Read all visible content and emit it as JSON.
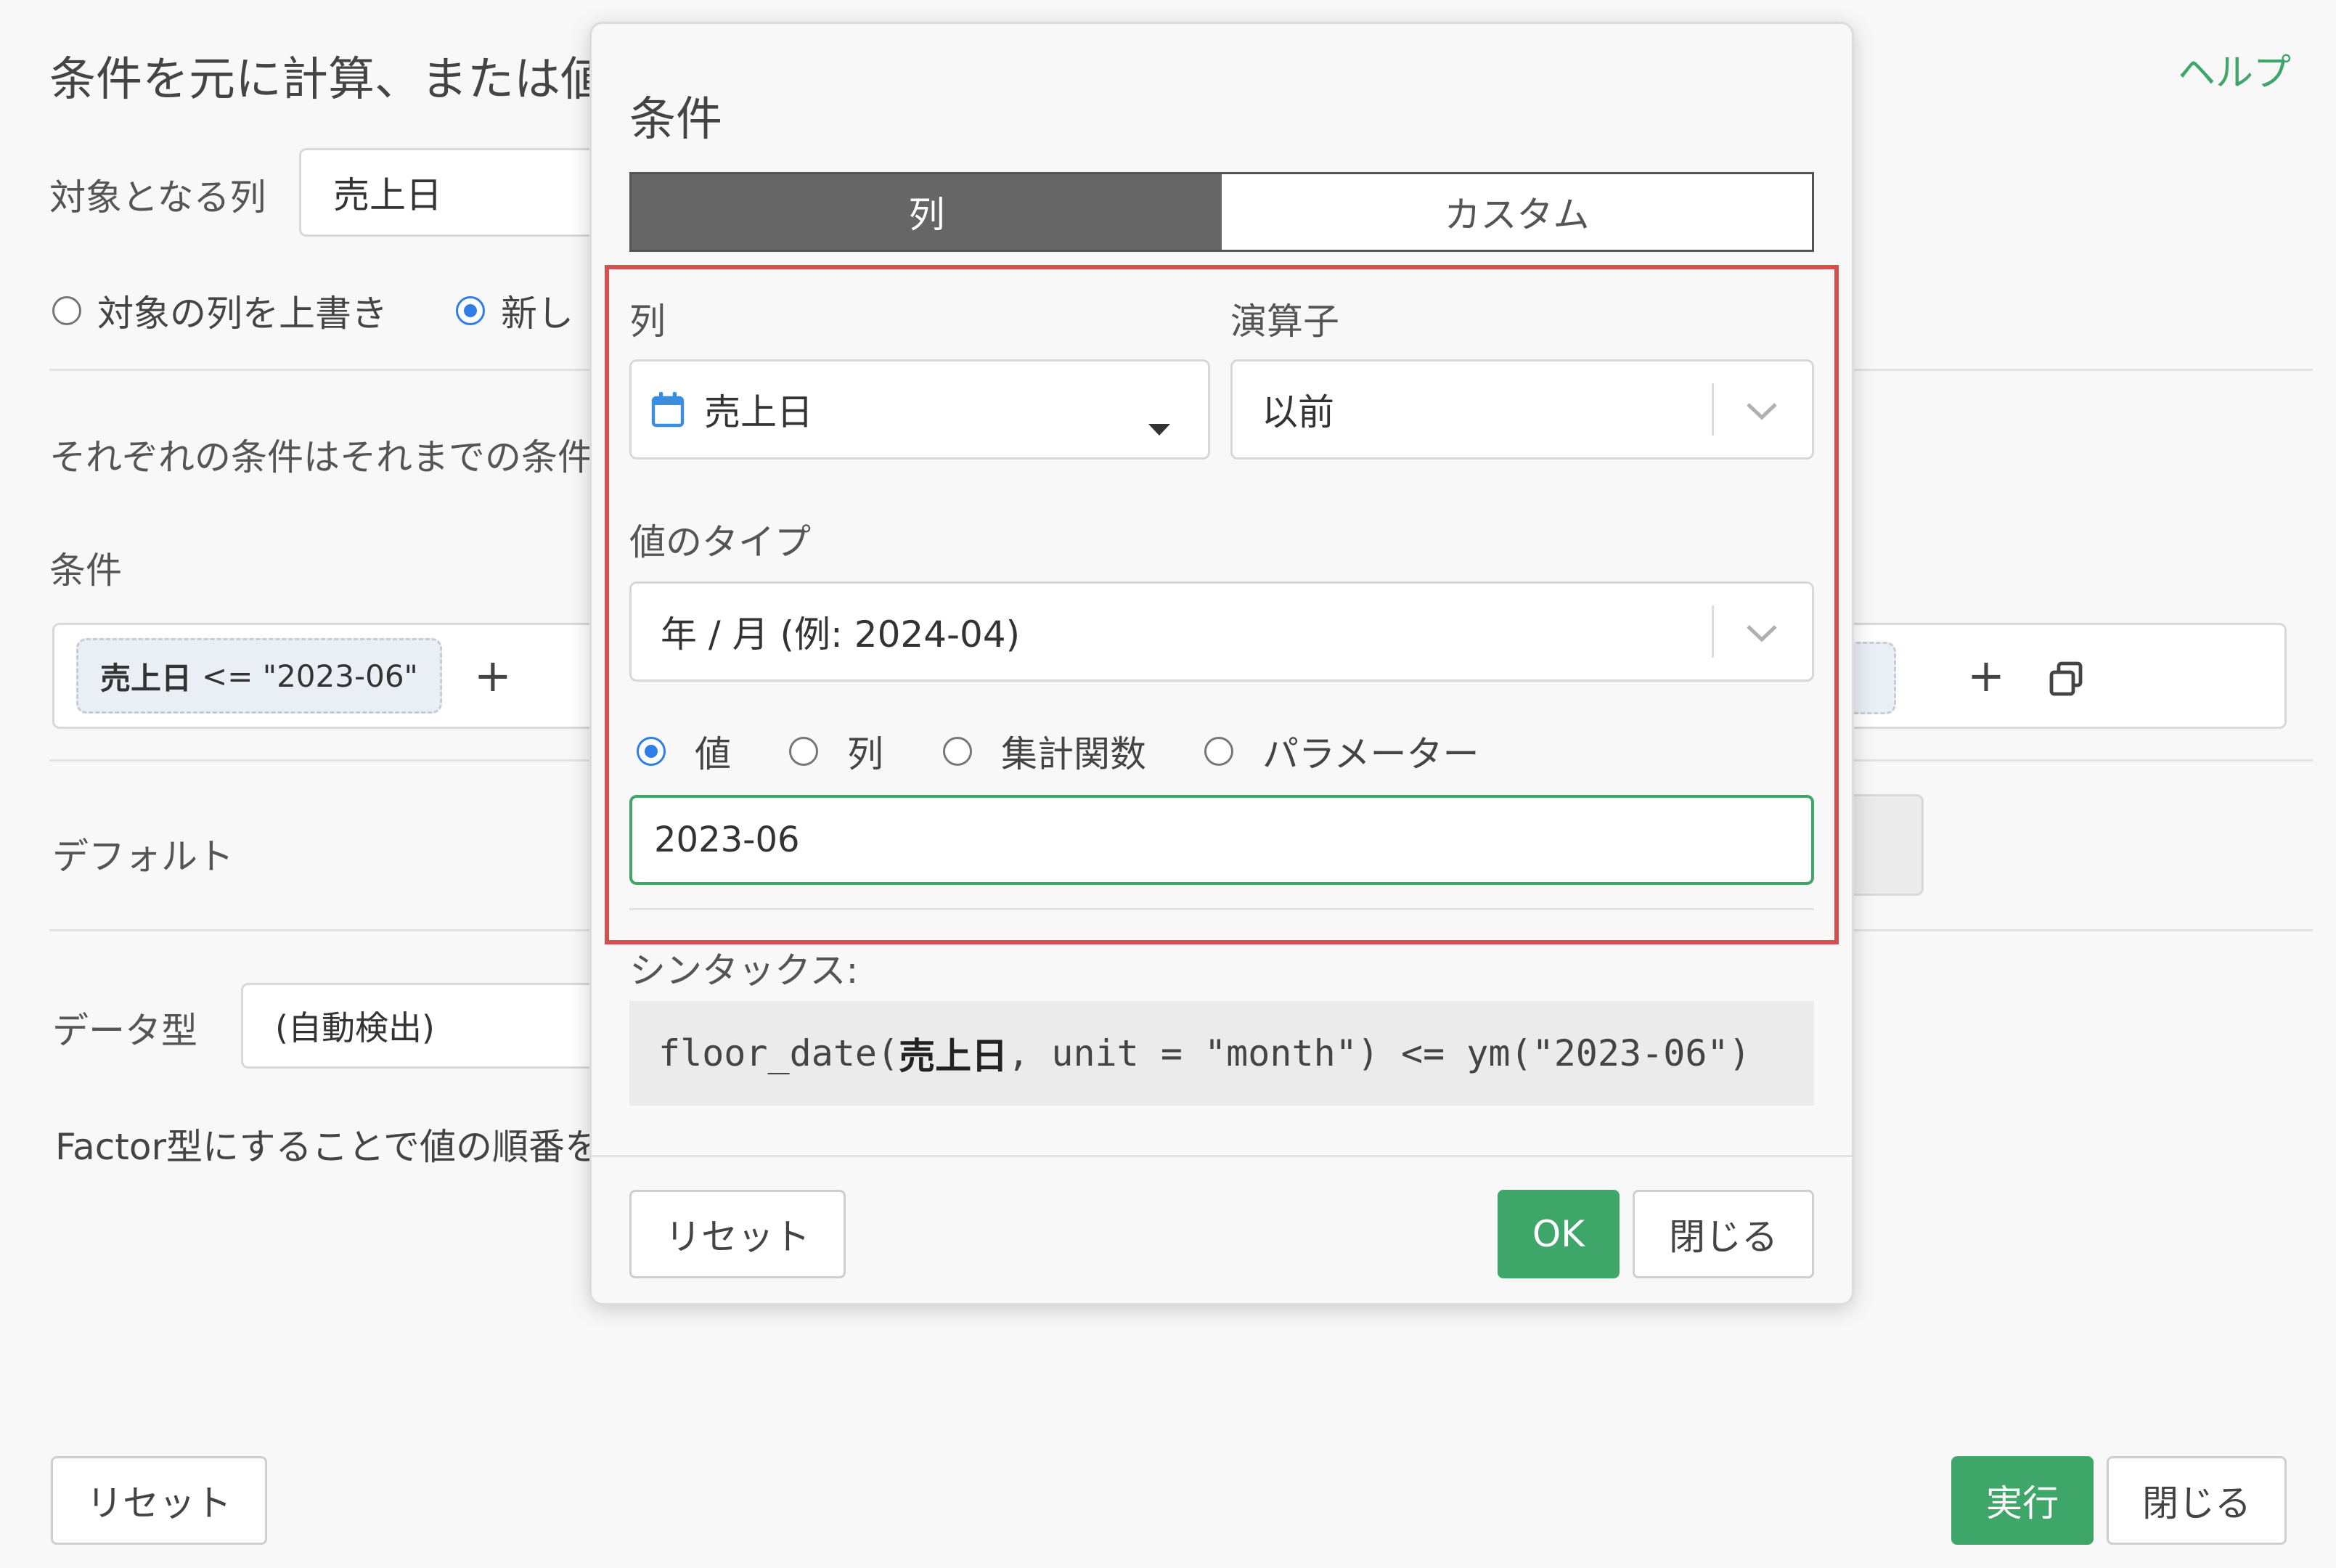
{
  "background": {
    "title": "条件を元に計算、または値",
    "help_link": "ヘルプ",
    "target_column_label": "対象となる列",
    "target_column_value": "売上日",
    "radio_overwrite": "対象の列を上書き",
    "radio_new": "新し",
    "description": "それぞれの条件はそれまでの条件",
    "conditions_label": "条件",
    "condition_chip": {
      "column": "売上日",
      "expr": "<= \"2023-06\""
    },
    "default_label": "デフォルト",
    "data_type_label": "データ型",
    "data_type_value": "(自動検出)",
    "factor_note": "Factor型にすることで値の順番を",
    "reset_button": "リセット",
    "run_button": "実行",
    "close_button": "閉じる"
  },
  "modal": {
    "title": "条件",
    "tabs": [
      "列",
      "カスタム"
    ],
    "active_tab": 0,
    "column_label": "列",
    "column_value": "売上日",
    "operator_label": "演算子",
    "operator_value": "以前",
    "value_type_label": "値のタイプ",
    "value_type_value": "年 / 月 (例: 2024-04)",
    "value_sources": [
      "値",
      "列",
      "集計関数",
      "パラメーター"
    ],
    "selected_value_source": 0,
    "value_input": "2023-06",
    "syntax_label": "シンタックス:",
    "syntax": {
      "pre": "floor_date(",
      "column": "売上日",
      "post": ", unit = \"month\") <= ym(\"2023-06\")"
    },
    "reset_button": "リセット",
    "ok_button": "OK",
    "close_button": "閉じる"
  },
  "colors": {
    "accent_green": "#3fa66a",
    "radio_blue": "#2f7ee8",
    "highlight_red": "#d4504e"
  }
}
